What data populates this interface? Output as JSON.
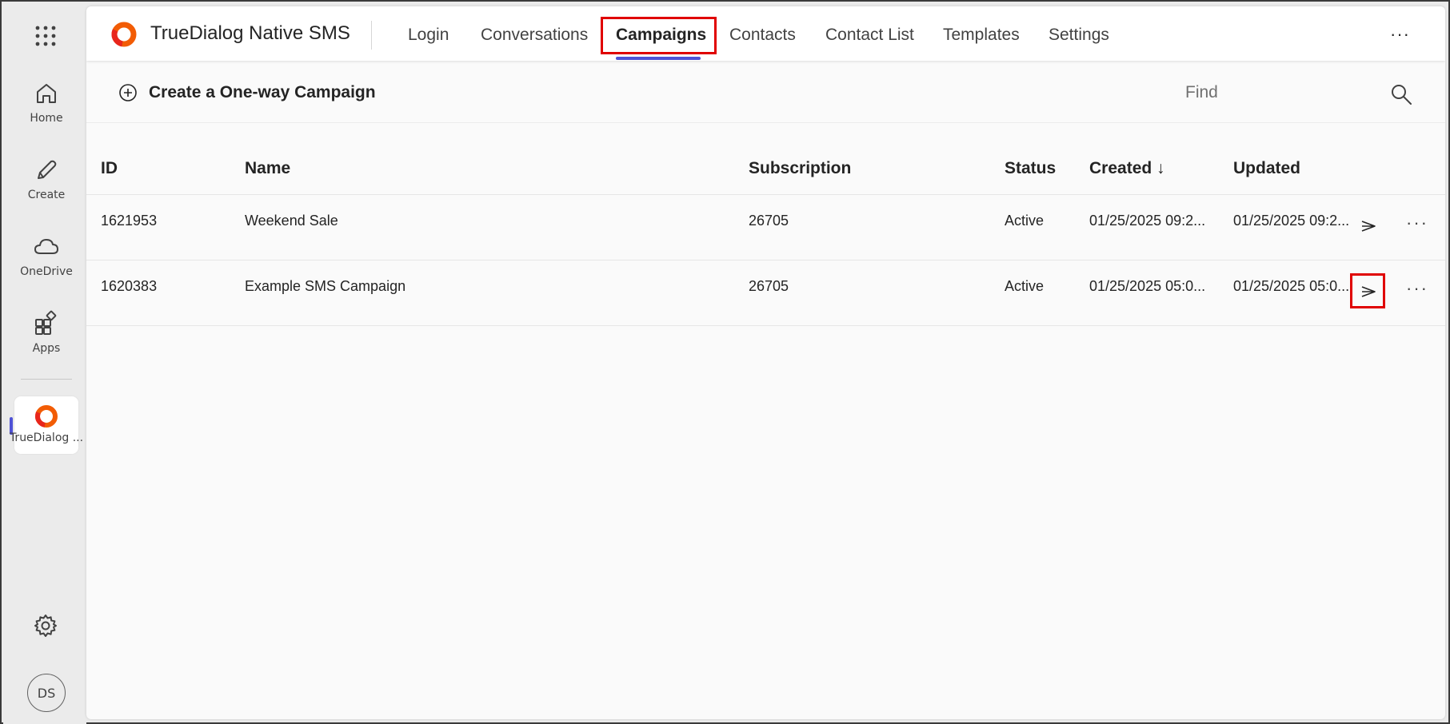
{
  "rail": {
    "items": [
      {
        "label": "Home",
        "icon": "home-icon"
      },
      {
        "label": "Create",
        "icon": "pencil-icon"
      },
      {
        "label": "OneDrive",
        "icon": "cloud-icon"
      },
      {
        "label": "Apps",
        "icon": "apps-icon"
      }
    ],
    "active_app_label": "TrueDialog ...",
    "avatar_initials": "DS"
  },
  "header": {
    "app_title": "TrueDialog Native SMS",
    "nav": [
      {
        "label": "Login"
      },
      {
        "label": "Conversations"
      },
      {
        "label": "Campaigns",
        "active": true
      },
      {
        "label": "Contacts"
      },
      {
        "label": "Contact List"
      },
      {
        "label": "Templates"
      },
      {
        "label": "Settings"
      }
    ],
    "more": "···"
  },
  "command_bar": {
    "create_label": "Create a One-way Campaign",
    "find_placeholder": "Find"
  },
  "table": {
    "columns": [
      "ID",
      "Name",
      "Subscription",
      "Status",
      "Created ↓",
      "Updated"
    ],
    "rows": [
      {
        "id": "1621953",
        "name": "Weekend Sale",
        "subscription": "26705",
        "status": "Active",
        "created": "01/25/2025 09:2...",
        "updated": "01/25/2025 09:2..."
      },
      {
        "id": "1620383",
        "name": "Example SMS Campaign",
        "subscription": "26705",
        "status": "Active",
        "created": "01/25/2025 05:0...",
        "updated": "01/25/2025 05:0..."
      }
    ],
    "row_more": "···"
  },
  "colors": {
    "accent": "#4f52d6",
    "highlight": "#e00000",
    "logo_orange": "#f25c05"
  }
}
